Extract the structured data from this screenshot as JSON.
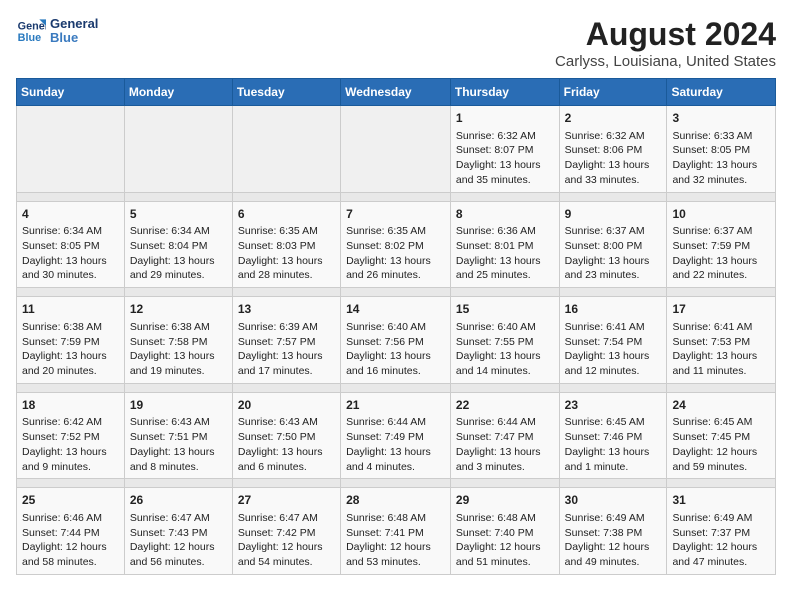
{
  "header": {
    "logo_line1": "General",
    "logo_line2": "Blue",
    "title": "August 2024",
    "subtitle": "Carlyss, Louisiana, United States"
  },
  "weekdays": [
    "Sunday",
    "Monday",
    "Tuesday",
    "Wednesday",
    "Thursday",
    "Friday",
    "Saturday"
  ],
  "weeks": [
    [
      {
        "day": "",
        "info": ""
      },
      {
        "day": "",
        "info": ""
      },
      {
        "day": "",
        "info": ""
      },
      {
        "day": "",
        "info": ""
      },
      {
        "day": "1",
        "info": "Sunrise: 6:32 AM\nSunset: 8:07 PM\nDaylight: 13 hours\nand 35 minutes."
      },
      {
        "day": "2",
        "info": "Sunrise: 6:32 AM\nSunset: 8:06 PM\nDaylight: 13 hours\nand 33 minutes."
      },
      {
        "day": "3",
        "info": "Sunrise: 6:33 AM\nSunset: 8:05 PM\nDaylight: 13 hours\nand 32 minutes."
      }
    ],
    [
      {
        "day": "4",
        "info": "Sunrise: 6:34 AM\nSunset: 8:05 PM\nDaylight: 13 hours\nand 30 minutes."
      },
      {
        "day": "5",
        "info": "Sunrise: 6:34 AM\nSunset: 8:04 PM\nDaylight: 13 hours\nand 29 minutes."
      },
      {
        "day": "6",
        "info": "Sunrise: 6:35 AM\nSunset: 8:03 PM\nDaylight: 13 hours\nand 28 minutes."
      },
      {
        "day": "7",
        "info": "Sunrise: 6:35 AM\nSunset: 8:02 PM\nDaylight: 13 hours\nand 26 minutes."
      },
      {
        "day": "8",
        "info": "Sunrise: 6:36 AM\nSunset: 8:01 PM\nDaylight: 13 hours\nand 25 minutes."
      },
      {
        "day": "9",
        "info": "Sunrise: 6:37 AM\nSunset: 8:00 PM\nDaylight: 13 hours\nand 23 minutes."
      },
      {
        "day": "10",
        "info": "Sunrise: 6:37 AM\nSunset: 7:59 PM\nDaylight: 13 hours\nand 22 minutes."
      }
    ],
    [
      {
        "day": "11",
        "info": "Sunrise: 6:38 AM\nSunset: 7:59 PM\nDaylight: 13 hours\nand 20 minutes."
      },
      {
        "day": "12",
        "info": "Sunrise: 6:38 AM\nSunset: 7:58 PM\nDaylight: 13 hours\nand 19 minutes."
      },
      {
        "day": "13",
        "info": "Sunrise: 6:39 AM\nSunset: 7:57 PM\nDaylight: 13 hours\nand 17 minutes."
      },
      {
        "day": "14",
        "info": "Sunrise: 6:40 AM\nSunset: 7:56 PM\nDaylight: 13 hours\nand 16 minutes."
      },
      {
        "day": "15",
        "info": "Sunrise: 6:40 AM\nSunset: 7:55 PM\nDaylight: 13 hours\nand 14 minutes."
      },
      {
        "day": "16",
        "info": "Sunrise: 6:41 AM\nSunset: 7:54 PM\nDaylight: 13 hours\nand 12 minutes."
      },
      {
        "day": "17",
        "info": "Sunrise: 6:41 AM\nSunset: 7:53 PM\nDaylight: 13 hours\nand 11 minutes."
      }
    ],
    [
      {
        "day": "18",
        "info": "Sunrise: 6:42 AM\nSunset: 7:52 PM\nDaylight: 13 hours\nand 9 minutes."
      },
      {
        "day": "19",
        "info": "Sunrise: 6:43 AM\nSunset: 7:51 PM\nDaylight: 13 hours\nand 8 minutes."
      },
      {
        "day": "20",
        "info": "Sunrise: 6:43 AM\nSunset: 7:50 PM\nDaylight: 13 hours\nand 6 minutes."
      },
      {
        "day": "21",
        "info": "Sunrise: 6:44 AM\nSunset: 7:49 PM\nDaylight: 13 hours\nand 4 minutes."
      },
      {
        "day": "22",
        "info": "Sunrise: 6:44 AM\nSunset: 7:47 PM\nDaylight: 13 hours\nand 3 minutes."
      },
      {
        "day": "23",
        "info": "Sunrise: 6:45 AM\nSunset: 7:46 PM\nDaylight: 13 hours\nand 1 minute."
      },
      {
        "day": "24",
        "info": "Sunrise: 6:45 AM\nSunset: 7:45 PM\nDaylight: 12 hours\nand 59 minutes."
      }
    ],
    [
      {
        "day": "25",
        "info": "Sunrise: 6:46 AM\nSunset: 7:44 PM\nDaylight: 12 hours\nand 58 minutes."
      },
      {
        "day": "26",
        "info": "Sunrise: 6:47 AM\nSunset: 7:43 PM\nDaylight: 12 hours\nand 56 minutes."
      },
      {
        "day": "27",
        "info": "Sunrise: 6:47 AM\nSunset: 7:42 PM\nDaylight: 12 hours\nand 54 minutes."
      },
      {
        "day": "28",
        "info": "Sunrise: 6:48 AM\nSunset: 7:41 PM\nDaylight: 12 hours\nand 53 minutes."
      },
      {
        "day": "29",
        "info": "Sunrise: 6:48 AM\nSunset: 7:40 PM\nDaylight: 12 hours\nand 51 minutes."
      },
      {
        "day": "30",
        "info": "Sunrise: 6:49 AM\nSunset: 7:38 PM\nDaylight: 12 hours\nand 49 minutes."
      },
      {
        "day": "31",
        "info": "Sunrise: 6:49 AM\nSunset: 7:37 PM\nDaylight: 12 hours\nand 47 minutes."
      }
    ]
  ]
}
